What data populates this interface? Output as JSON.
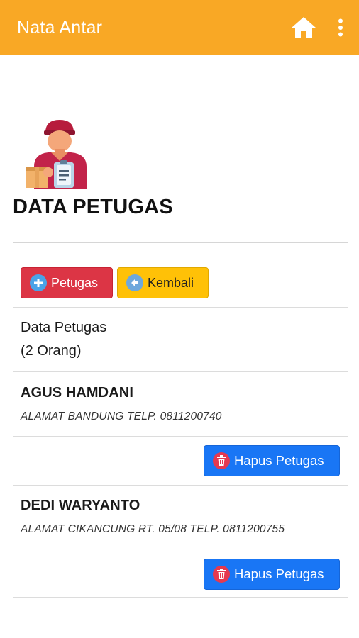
{
  "app_bar": {
    "title": "Nata Antar",
    "icons": {
      "home": "home-icon",
      "more": "more-vert-icon"
    },
    "color": "#f9a825"
  },
  "page": {
    "title": "DATA PETUGAS",
    "hero_icon": "courier-person-icon"
  },
  "actions": {
    "add_label": "Petugas",
    "back_label": "Kembali",
    "add_color": "#dc3545",
    "back_color": "#ffc107"
  },
  "summary": {
    "title": "Data Petugas",
    "count": "(2 Orang)"
  },
  "officers": [
    {
      "name": "AGUS HAMDANI",
      "detail": "ALAMAT BANDUNG TELP. 0811200740",
      "delete_label": "Hapus Petugas"
    },
    {
      "name": "DEDI WARYANTO",
      "detail": "ALAMAT CIKANCUNG RT. 05/08 TELP. 0811200755",
      "delete_label": "Hapus Petugas"
    }
  ],
  "delete_color": "#1976f5"
}
